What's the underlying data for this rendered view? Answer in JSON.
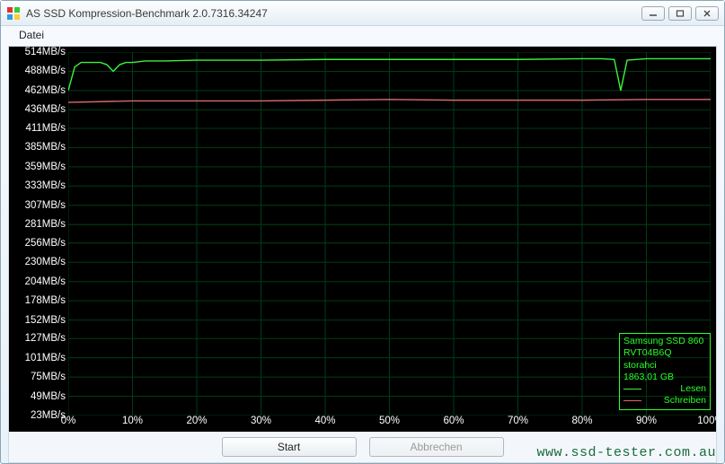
{
  "window": {
    "title": "AS SSD Kompression-Benchmark 2.0.7316.34247"
  },
  "menu": {
    "file": "Datei"
  },
  "buttons": {
    "start": "Start",
    "cancel": "Abbrechen"
  },
  "legend_box": {
    "device": "Samsung SSD 860",
    "firmware": "RVT04B6Q",
    "driver": "storahci",
    "capacity": "1863,01 GB",
    "read_label": "Lesen",
    "write_label": "Schreiben"
  },
  "watermark": "www.ssd-tester.com.au",
  "chart_data": {
    "type": "line",
    "xlabel": "",
    "ylabel": "",
    "x_unit": "%",
    "y_unit": "MB/s",
    "xlim": [
      0,
      100
    ],
    "ylim": [
      23,
      514
    ],
    "x_ticks": [
      0,
      10,
      20,
      30,
      40,
      50,
      60,
      70,
      80,
      90,
      100
    ],
    "y_ticks": [
      514,
      488,
      462,
      436,
      411,
      385,
      359,
      333,
      307,
      281,
      256,
      230,
      204,
      178,
      152,
      127,
      101,
      75,
      49,
      23
    ],
    "y_tick_labels": [
      "514MB/s",
      "488MB/s",
      "462MB/s",
      "436MB/s",
      "411MB/s",
      "385MB/s",
      "359MB/s",
      "333MB/s",
      "307MB/s",
      "281MB/s",
      "256MB/s",
      "230MB/s",
      "204MB/s",
      "178MB/s",
      "152MB/s",
      "127MB/s",
      "101MB/s",
      "75MB/s",
      "49MB/s",
      "23MB/s"
    ],
    "x_tick_labels": [
      "0%",
      "10%",
      "20%",
      "30%",
      "40%",
      "50%",
      "60%",
      "70%",
      "80%",
      "90%",
      "100%"
    ],
    "series": [
      {
        "name": "Lesen",
        "color": "#3cf03c",
        "x": [
          0,
          1,
          2,
          3,
          5,
          6,
          7,
          8,
          9,
          10,
          12,
          15,
          20,
          30,
          40,
          50,
          60,
          70,
          80,
          83,
          85,
          86,
          87,
          90,
          95,
          100
        ],
        "values": [
          462,
          494,
          500,
          500,
          500,
          497,
          488,
          497,
          500,
          500,
          502,
          502,
          503,
          503,
          504,
          504,
          504,
          504,
          505,
          505,
          504,
          462,
          503,
          505,
          505,
          505
        ]
      },
      {
        "name": "Schreiben",
        "color": "#d86a6a",
        "x": [
          0,
          5,
          10,
          20,
          30,
          40,
          50,
          60,
          70,
          80,
          90,
          100
        ],
        "values": [
          446,
          447,
          448,
          448,
          448,
          449,
          450,
          449,
          449,
          449,
          450,
          450
        ]
      }
    ]
  }
}
